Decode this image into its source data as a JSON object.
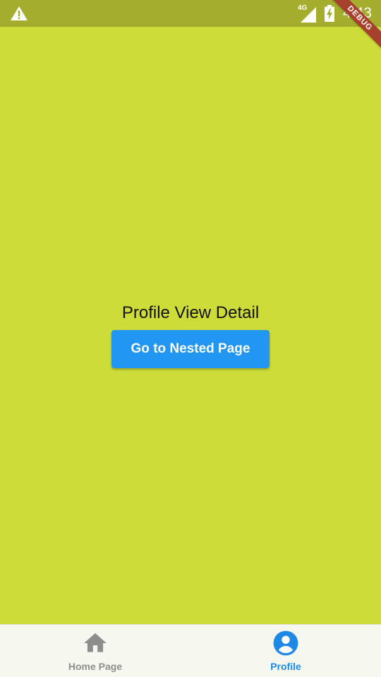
{
  "status_bar": {
    "network_label": "4G",
    "time": "4:43",
    "warning_icon": "warning-icon",
    "signal_icon": "cell-signal-icon",
    "battery_icon": "battery-charging-icon"
  },
  "debug_banner": {
    "label": "DEBUG"
  },
  "main": {
    "title": "Profile View Detail",
    "button_label": "Go to Nested Page",
    "background_color": "#cddc39",
    "button_color": "#2196f3"
  },
  "bottom_nav": {
    "items": [
      {
        "label": "Home Page",
        "icon": "home-icon",
        "selected": false
      },
      {
        "label": "Profile",
        "icon": "account-circle-icon",
        "selected": true
      }
    ],
    "selected_color": "#1e88e5",
    "unselected_color": "#8e8e8e"
  }
}
